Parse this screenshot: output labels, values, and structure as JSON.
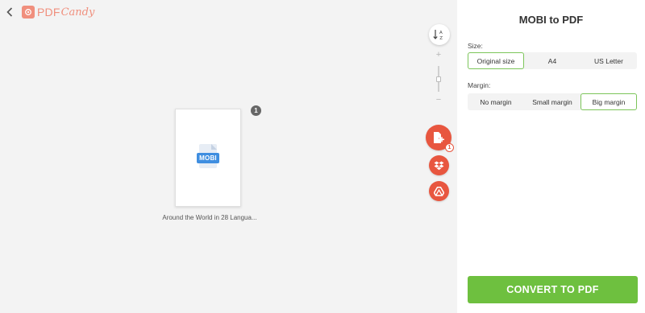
{
  "header": {
    "back_icon": "chevron-left-icon",
    "logo_pdf": "PDF",
    "logo_candy": "Candy"
  },
  "file": {
    "type_label": "MOBI",
    "name": "Around the World in 28 Langua...",
    "count": "1"
  },
  "tools": {
    "sort_icon": "sort-az-icon",
    "zoom_plus": "+",
    "zoom_minus": "−",
    "zoom_level": 0.5,
    "add_badge": "1"
  },
  "panel": {
    "title": "MOBI to PDF",
    "size_label": "Size:",
    "size_options": [
      "Original size",
      "A4",
      "US Letter"
    ],
    "size_selected": "Original size",
    "margin_label": "Margin:",
    "margin_options": [
      "No margin",
      "Small margin",
      "Big margin"
    ],
    "margin_selected": "Big margin",
    "convert_label": "CONVERT TO PDF"
  },
  "colors": {
    "accent_green": "#6ec03f",
    "action_red": "#e8563f",
    "logo_coral": "#f08f7d",
    "mobi_blue": "#3f8ee0"
  }
}
